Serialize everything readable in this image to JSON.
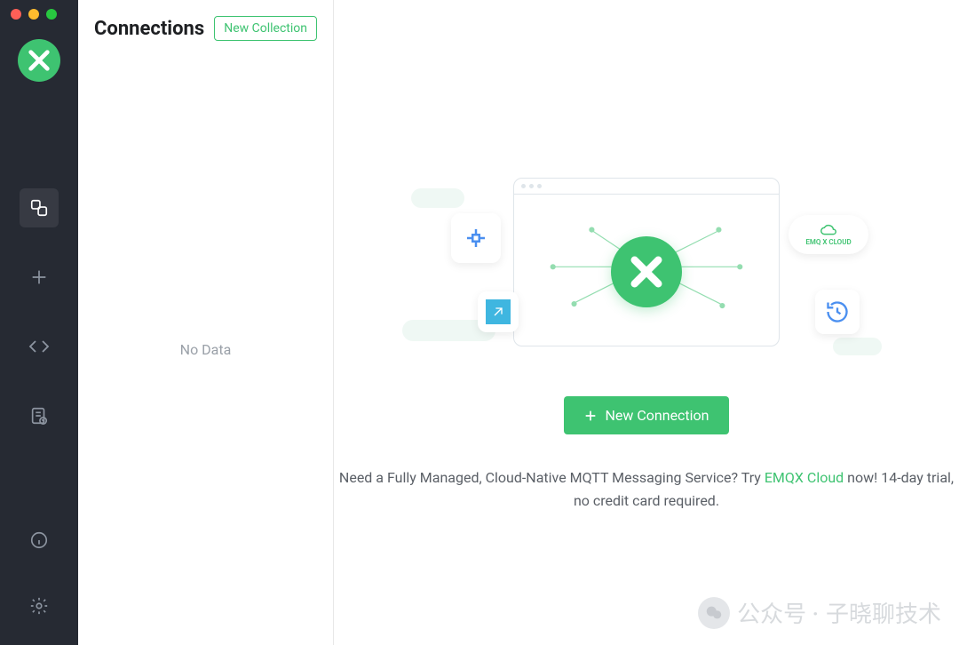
{
  "sidebar": {
    "title": "Connections",
    "new_collection_label": "New Collection",
    "no_data": "No Data"
  },
  "nav": {
    "items": [
      {
        "name": "connections-icon",
        "active": true
      },
      {
        "name": "plus-icon",
        "active": false
      },
      {
        "name": "code-icon",
        "active": false
      },
      {
        "name": "log-icon",
        "active": false
      }
    ],
    "bottom": [
      {
        "name": "info-icon"
      },
      {
        "name": "settings-icon"
      }
    ]
  },
  "main": {
    "new_connection_label": "New Connection",
    "promo_prefix": "Need a Fully Managed, Cloud-Native MQTT Messaging Service? Try ",
    "promo_link": "EMQX Cloud",
    "promo_suffix": " now! 14-day trial, no credit card required.",
    "cloud_card_label": "EMQ X CLOUD"
  },
  "watermark": {
    "prefix": "公众号 · ",
    "name": "子晓聊技术"
  },
  "colors": {
    "accent": "#3ec371",
    "nav_bg": "#262a33"
  }
}
